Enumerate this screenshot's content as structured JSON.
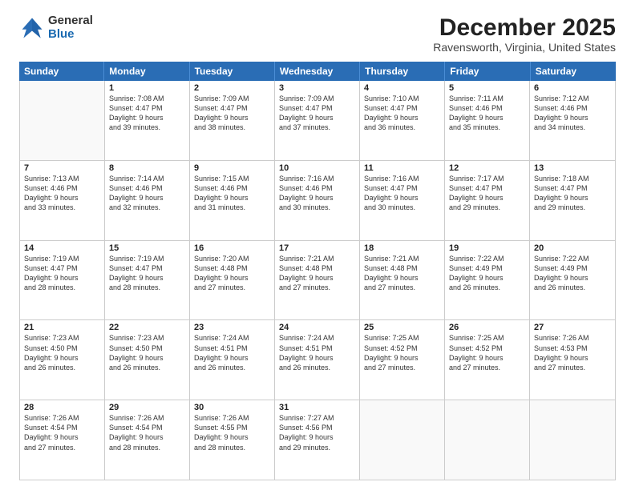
{
  "logo": {
    "general": "General",
    "blue": "Blue"
  },
  "title": "December 2025",
  "subtitle": "Ravensworth, Virginia, United States",
  "days": [
    "Sunday",
    "Monday",
    "Tuesday",
    "Wednesday",
    "Thursday",
    "Friday",
    "Saturday"
  ],
  "weeks": [
    [
      {
        "day": "",
        "info": ""
      },
      {
        "day": "1",
        "info": "Sunrise: 7:08 AM\nSunset: 4:47 PM\nDaylight: 9 hours\nand 39 minutes."
      },
      {
        "day": "2",
        "info": "Sunrise: 7:09 AM\nSunset: 4:47 PM\nDaylight: 9 hours\nand 38 minutes."
      },
      {
        "day": "3",
        "info": "Sunrise: 7:09 AM\nSunset: 4:47 PM\nDaylight: 9 hours\nand 37 minutes."
      },
      {
        "day": "4",
        "info": "Sunrise: 7:10 AM\nSunset: 4:47 PM\nDaylight: 9 hours\nand 36 minutes."
      },
      {
        "day": "5",
        "info": "Sunrise: 7:11 AM\nSunset: 4:46 PM\nDaylight: 9 hours\nand 35 minutes."
      },
      {
        "day": "6",
        "info": "Sunrise: 7:12 AM\nSunset: 4:46 PM\nDaylight: 9 hours\nand 34 minutes."
      }
    ],
    [
      {
        "day": "7",
        "info": "Sunrise: 7:13 AM\nSunset: 4:46 PM\nDaylight: 9 hours\nand 33 minutes."
      },
      {
        "day": "8",
        "info": "Sunrise: 7:14 AM\nSunset: 4:46 PM\nDaylight: 9 hours\nand 32 minutes."
      },
      {
        "day": "9",
        "info": "Sunrise: 7:15 AM\nSunset: 4:46 PM\nDaylight: 9 hours\nand 31 minutes."
      },
      {
        "day": "10",
        "info": "Sunrise: 7:16 AM\nSunset: 4:46 PM\nDaylight: 9 hours\nand 30 minutes."
      },
      {
        "day": "11",
        "info": "Sunrise: 7:16 AM\nSunset: 4:47 PM\nDaylight: 9 hours\nand 30 minutes."
      },
      {
        "day": "12",
        "info": "Sunrise: 7:17 AM\nSunset: 4:47 PM\nDaylight: 9 hours\nand 29 minutes."
      },
      {
        "day": "13",
        "info": "Sunrise: 7:18 AM\nSunset: 4:47 PM\nDaylight: 9 hours\nand 29 minutes."
      }
    ],
    [
      {
        "day": "14",
        "info": "Sunrise: 7:19 AM\nSunset: 4:47 PM\nDaylight: 9 hours\nand 28 minutes."
      },
      {
        "day": "15",
        "info": "Sunrise: 7:19 AM\nSunset: 4:47 PM\nDaylight: 9 hours\nand 28 minutes."
      },
      {
        "day": "16",
        "info": "Sunrise: 7:20 AM\nSunset: 4:48 PM\nDaylight: 9 hours\nand 27 minutes."
      },
      {
        "day": "17",
        "info": "Sunrise: 7:21 AM\nSunset: 4:48 PM\nDaylight: 9 hours\nand 27 minutes."
      },
      {
        "day": "18",
        "info": "Sunrise: 7:21 AM\nSunset: 4:48 PM\nDaylight: 9 hours\nand 27 minutes."
      },
      {
        "day": "19",
        "info": "Sunrise: 7:22 AM\nSunset: 4:49 PM\nDaylight: 9 hours\nand 26 minutes."
      },
      {
        "day": "20",
        "info": "Sunrise: 7:22 AM\nSunset: 4:49 PM\nDaylight: 9 hours\nand 26 minutes."
      }
    ],
    [
      {
        "day": "21",
        "info": "Sunrise: 7:23 AM\nSunset: 4:50 PM\nDaylight: 9 hours\nand 26 minutes."
      },
      {
        "day": "22",
        "info": "Sunrise: 7:23 AM\nSunset: 4:50 PM\nDaylight: 9 hours\nand 26 minutes."
      },
      {
        "day": "23",
        "info": "Sunrise: 7:24 AM\nSunset: 4:51 PM\nDaylight: 9 hours\nand 26 minutes."
      },
      {
        "day": "24",
        "info": "Sunrise: 7:24 AM\nSunset: 4:51 PM\nDaylight: 9 hours\nand 26 minutes."
      },
      {
        "day": "25",
        "info": "Sunrise: 7:25 AM\nSunset: 4:52 PM\nDaylight: 9 hours\nand 27 minutes."
      },
      {
        "day": "26",
        "info": "Sunrise: 7:25 AM\nSunset: 4:52 PM\nDaylight: 9 hours\nand 27 minutes."
      },
      {
        "day": "27",
        "info": "Sunrise: 7:26 AM\nSunset: 4:53 PM\nDaylight: 9 hours\nand 27 minutes."
      }
    ],
    [
      {
        "day": "28",
        "info": "Sunrise: 7:26 AM\nSunset: 4:54 PM\nDaylight: 9 hours\nand 27 minutes."
      },
      {
        "day": "29",
        "info": "Sunrise: 7:26 AM\nSunset: 4:54 PM\nDaylight: 9 hours\nand 28 minutes."
      },
      {
        "day": "30",
        "info": "Sunrise: 7:26 AM\nSunset: 4:55 PM\nDaylight: 9 hours\nand 28 minutes."
      },
      {
        "day": "31",
        "info": "Sunrise: 7:27 AM\nSunset: 4:56 PM\nDaylight: 9 hours\nand 29 minutes."
      },
      {
        "day": "",
        "info": ""
      },
      {
        "day": "",
        "info": ""
      },
      {
        "day": "",
        "info": ""
      }
    ]
  ]
}
